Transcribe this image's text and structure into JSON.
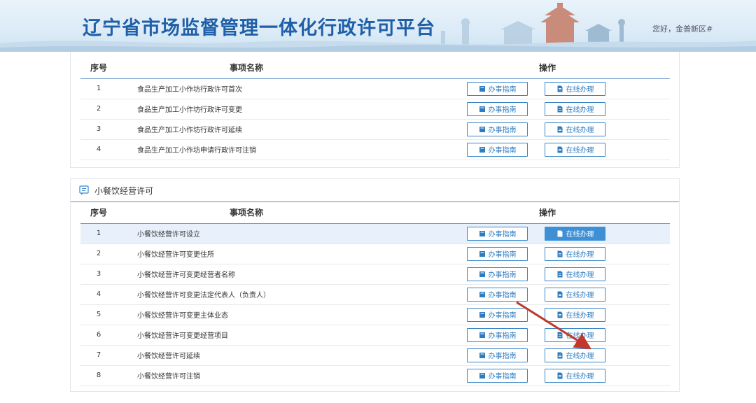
{
  "header": {
    "title": "辽宁省市场监督管理一体化行政许可平台",
    "greeting": "您好，金普新区#"
  },
  "columns": {
    "seq": "序号",
    "name": "事项名称",
    "ops": "操作"
  },
  "buttons": {
    "guide": "办事指南",
    "online": "在线办理"
  },
  "section1": {
    "rows": [
      {
        "seq": "1",
        "name": "食品生产加工小作坊行政许可首次"
      },
      {
        "seq": "2",
        "name": "食品生产加工小作坊行政许可变更"
      },
      {
        "seq": "3",
        "name": "食品生产加工小作坊行政许可延续"
      },
      {
        "seq": "4",
        "name": "食品生产加工小作坊申请行政许可注销"
      }
    ]
  },
  "section2": {
    "title": "小餐饮经营许可",
    "rows": [
      {
        "seq": "1",
        "name": "小餐饮经营许可设立"
      },
      {
        "seq": "2",
        "name": "小餐饮经营许可变更住所"
      },
      {
        "seq": "3",
        "name": "小餐饮经营许可变更经营者名称"
      },
      {
        "seq": "4",
        "name": "小餐饮经营许可变更法定代表人（负责人）"
      },
      {
        "seq": "5",
        "name": "小餐饮经营许可变更主体业态"
      },
      {
        "seq": "6",
        "name": "小餐饮经营许可变更经营项目"
      },
      {
        "seq": "7",
        "name": "小餐饮经营许可延续"
      },
      {
        "seq": "8",
        "name": "小餐饮经营许可注销"
      }
    ]
  },
  "colors": {
    "accent": "#1f5fa8",
    "button": "#3a86c8",
    "highlight_row": "#e8f1fb",
    "arrow": "#c0392b"
  },
  "icons": {
    "guide": "book-icon",
    "online": "document-icon",
    "section": "message-list-icon"
  }
}
